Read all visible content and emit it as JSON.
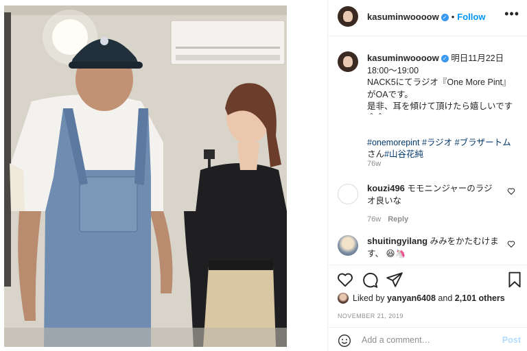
{
  "header": {
    "username": "kasuminwoooow",
    "separator": "•",
    "follow_label": "Follow",
    "more_label": "•••"
  },
  "caption": {
    "username": "kasuminwoooow",
    "line1": "明日11月22日",
    "line2": "18:00〜19:00",
    "line3": "NACK5にてラジオ『One More Pint』",
    "line4": "がOAです。",
    "line5": "是非、耳を傾けて頂けたら嬉しいです",
    "line6": "＾＾",
    "tag1": "#onemorepint",
    "tag2": "#ラジオ",
    "tag3": "#ブラザートム",
    "tag3_suffix": "さん",
    "tag4": "#山谷花純",
    "time": "76w"
  },
  "comments": [
    {
      "username": "kouzi496",
      "text": "モモニンジャーのラジオ良いな",
      "time": "76w",
      "reply_label": "Reply"
    },
    {
      "username": "shuitingyilang",
      "text": "みみをかたむけます、",
      "emoji": "😆🦄"
    }
  ],
  "likes": {
    "prefix": "Liked by",
    "user": "yanyan6408",
    "connector": "and",
    "count": "2,101 others"
  },
  "date": "NOVEMBER 21, 2019",
  "add_comment": {
    "placeholder": "Add a comment…",
    "post_label": "Post"
  },
  "colors": {
    "link": "#0095f6",
    "hashtag": "#00376b",
    "verified": "#3897f0",
    "meta": "#8e8e8e"
  },
  "icons": [
    "verified-badge-icon",
    "heart-icon",
    "comment-icon",
    "share-icon",
    "bookmark-icon",
    "emoji-icon"
  ]
}
